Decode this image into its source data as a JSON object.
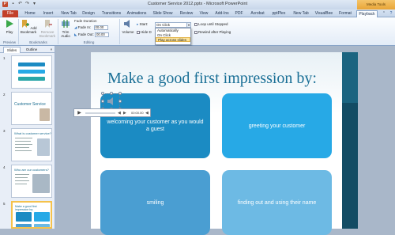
{
  "window": {
    "title": "Customer Service 2012.pptx  -  Microsoft PowerPoint",
    "context_tab_label": "Media Tools"
  },
  "tabs": [
    "File",
    "Home",
    "Insert",
    "New Tab",
    "Design",
    "Transitions",
    "Animations",
    "Slide Show",
    "Review",
    "View",
    "Add-Ins",
    "PDF",
    "Acrobat",
    "pptPlex",
    "New Tab",
    "VisualBee",
    "Format",
    "Playback"
  ],
  "ribbon": {
    "preview": {
      "play_label": "Play",
      "group_label": "Preview"
    },
    "bookmarks": {
      "add_label": "Add Bookmark",
      "remove_label": "Remove Bookmark",
      "group_label": "Bookmarks"
    },
    "editing": {
      "trim_label": "Trim Audio",
      "fade_duration_label": "Fade Duration",
      "fade_in_label": "Fade In:",
      "fade_in_value": "00.00",
      "fade_out_label": "Fade Out:",
      "fade_out_value": "00.00",
      "group_label": "Editing"
    },
    "audio_options": {
      "volume_label": "Volume",
      "start_label": "Start:",
      "start_value": "On Click",
      "hide_label": "Hide D",
      "loop_label": "Loop until Stopped",
      "rewind_label": "Rewind after Playing"
    },
    "start_menu": [
      "Automatically",
      "On Click",
      "Play across slides"
    ]
  },
  "left_panel": {
    "tabs": [
      "Slides",
      "Outline"
    ],
    "slide_numbers": [
      "1",
      "2",
      "3",
      "4",
      "5"
    ],
    "thumb_titles": [
      "",
      "Customer Service",
      "What is customer service?",
      "Who are our customers?",
      "Make a good first impression by:"
    ]
  },
  "slide": {
    "title": "Make a good first impression by:",
    "cards": [
      "welcoming your customer as you would a guest",
      "greeting your customer",
      "smiling",
      "finding out and using their name"
    ]
  },
  "player": {
    "time": "00:00.00"
  },
  "colors": {
    "accent": "#1b8bc3",
    "file_tab": "#c2402a",
    "slide_title": "#1a6f96"
  }
}
